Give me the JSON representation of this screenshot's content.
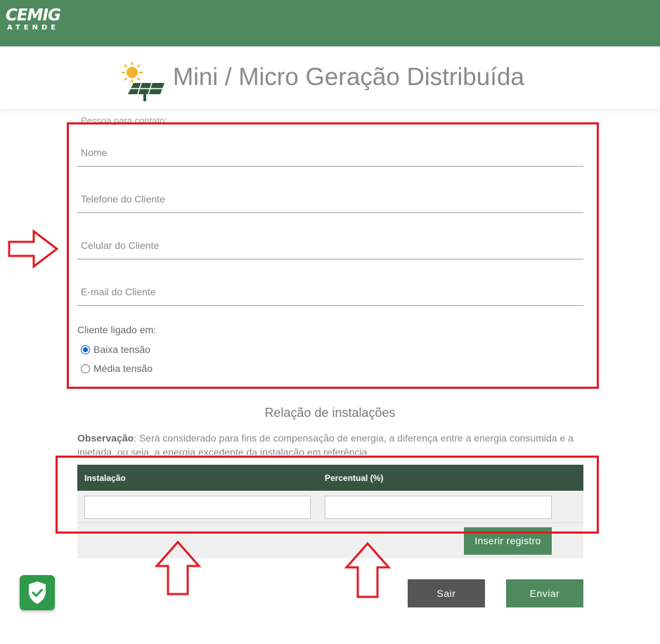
{
  "brand": {
    "logo_main": "CEMIG",
    "logo_sub": "ATENDE",
    "color": "#4f8a5f"
  },
  "header": {
    "title": "Mini / Micro Geração Distribuída",
    "icon": "solar-panel-icon"
  },
  "contact": {
    "section_label": "Pessoa para contato:",
    "fields": [
      {
        "name": "name",
        "placeholder": "Nome",
        "value": ""
      },
      {
        "name": "phone",
        "placeholder": "Telefone do Cliente",
        "value": ""
      },
      {
        "name": "mobile",
        "placeholder": "Celular do Cliente",
        "value": ""
      },
      {
        "name": "email",
        "placeholder": "E-mail do Cliente",
        "value": ""
      }
    ],
    "connection_label": "Cliente ligado em:",
    "options": [
      {
        "label": "Baixa tensão",
        "checked": true
      },
      {
        "label": "Média tensão",
        "checked": false
      }
    ]
  },
  "installations": {
    "title": "Relação de instalações",
    "note_label": "Observação",
    "note_text": ": Será considerado para fins de compensação de energia, a diferença entre a energia consumida e a injetada, ou seja, a energia excedente da instalação em referência.",
    "columns": [
      "Instalação",
      "Percentual (%)"
    ],
    "row": {
      "installation": "",
      "percent": ""
    },
    "insert_label": "Inserir registro",
    "header_color": "#375341"
  },
  "actions": {
    "exit_label": "Sair",
    "send_label": "Enviar"
  },
  "badge": {
    "icon": "shield-check-icon"
  },
  "annotation_color": "#e01b24"
}
